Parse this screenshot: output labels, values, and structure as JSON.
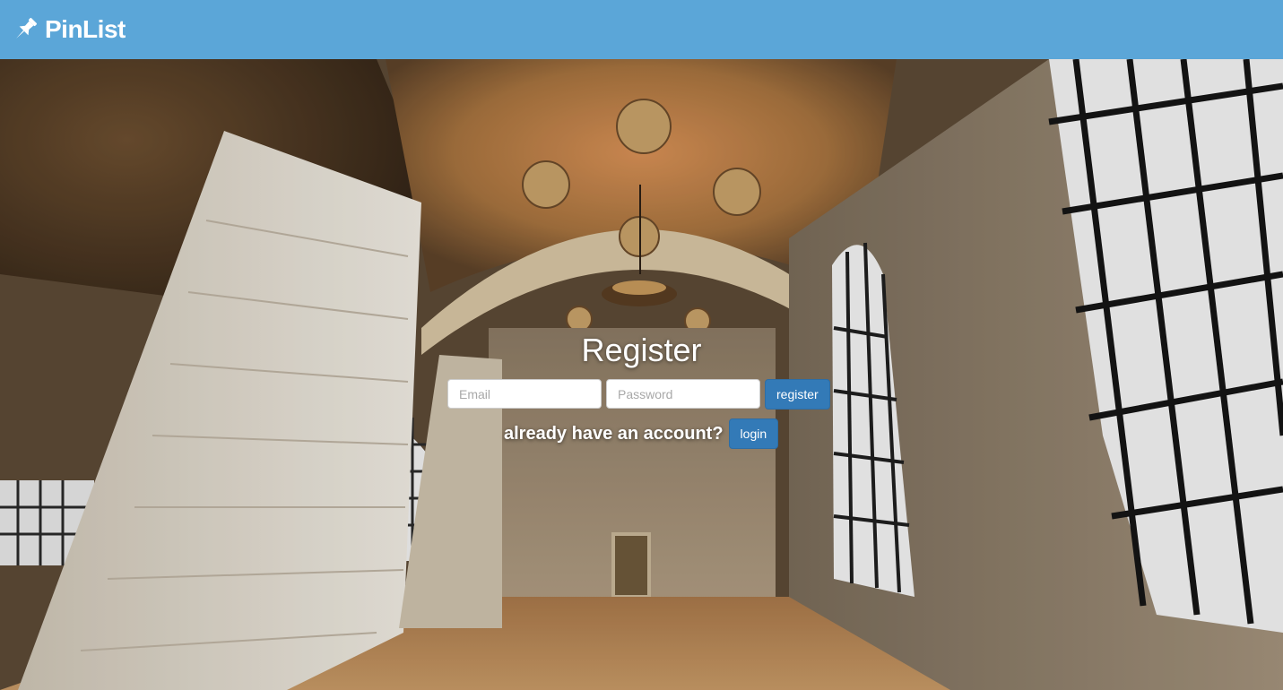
{
  "header": {
    "brand_name": "PinList",
    "brand_icon": "pushpin-icon",
    "bg_color": "#5ba6d8"
  },
  "hero": {
    "background_image": "vaulted-hall-photo"
  },
  "register": {
    "title": "Register",
    "email_placeholder": "Email",
    "password_placeholder": "Password",
    "register_button": "register",
    "login_prompt": "already have an account?",
    "login_button": "login",
    "button_color": "#337ab7"
  }
}
